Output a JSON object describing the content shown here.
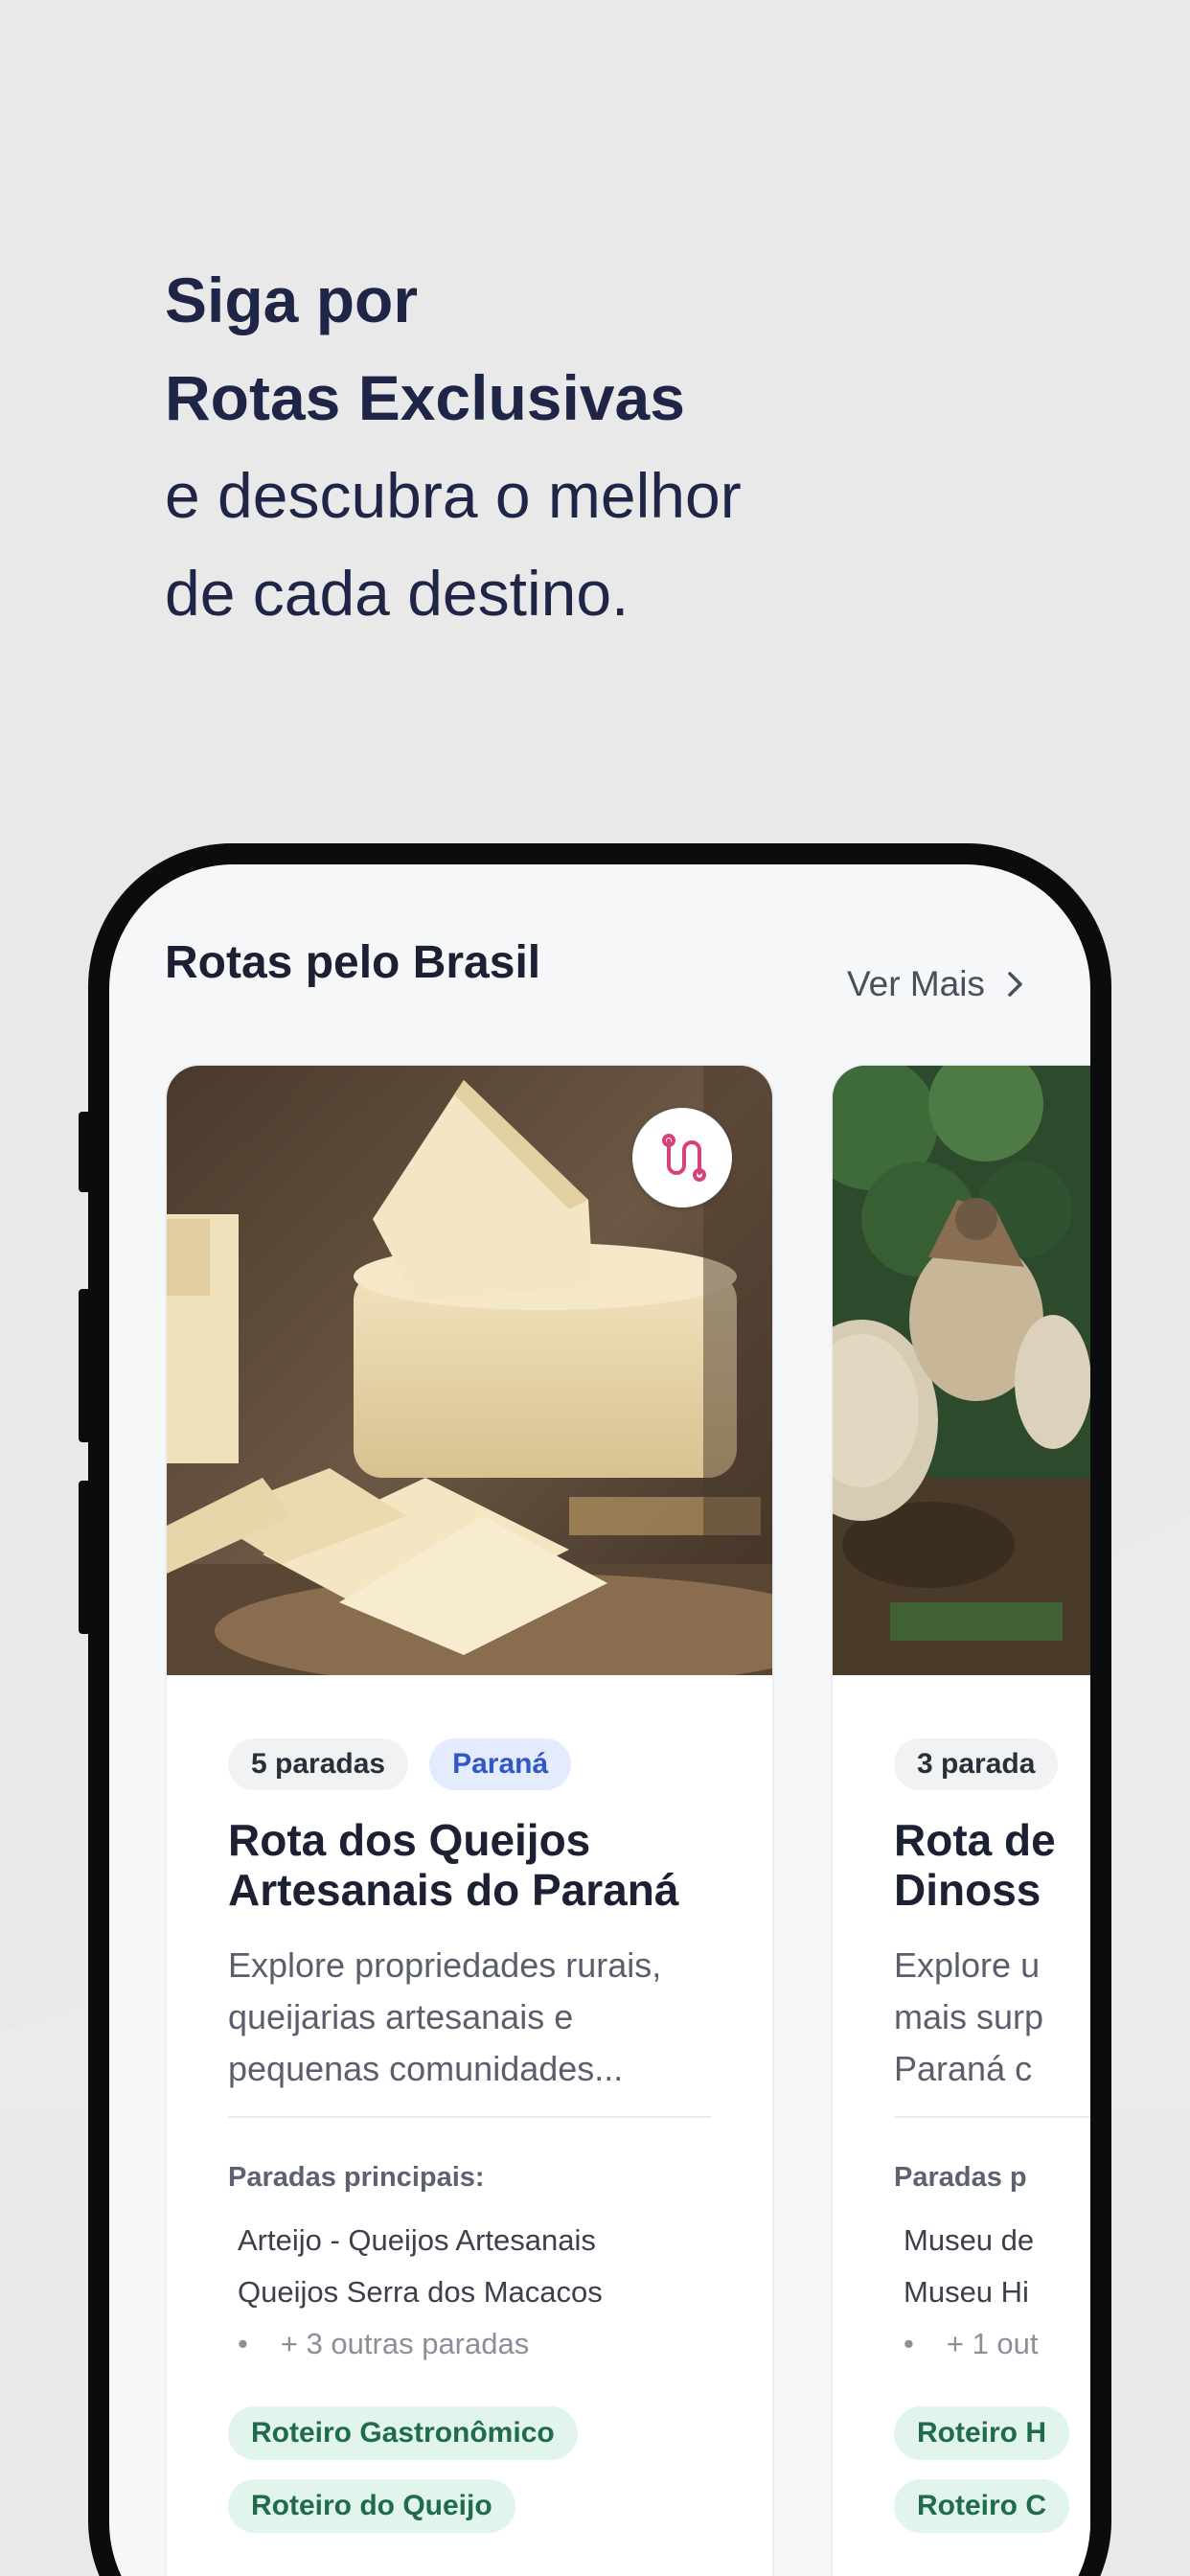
{
  "headline": {
    "line1": "Siga por",
    "line2": "Rotas Exclusivas",
    "line3": "e descubra o melhor",
    "line4": "de cada destino."
  },
  "section": {
    "title": "Rotas pelo Brasil",
    "see_more": "Ver Mais"
  },
  "cards": [
    {
      "stops_count": "5 paradas",
      "state": "Paraná",
      "title": "Rota dos Queijos Artesanais do Paraná",
      "description": "Explore propriedades rurais, queijarias artesanais e pequenas comunidades...",
      "stops_label": "Paradas principais:",
      "stops": [
        "Arteijo - Queijos Artesanais",
        "Queijos Serra dos Macacos"
      ],
      "more_stops": "+ 3 outras paradas",
      "tags": [
        "Roteiro Gastronômico",
        "Roteiro do Queijo"
      ]
    },
    {
      "stops_count": "3 parada",
      "title": "Rota de Dinoss",
      "description": "Explore u mais surp Paraná c",
      "stops_label": "Paradas p",
      "stops": [
        "Museu de",
        "Museu Hi"
      ],
      "more_stops": "+ 1 out",
      "tags": [
        "Roteiro H",
        "Roteiro C"
      ]
    }
  ],
  "colors": {
    "headline": "#1e2547",
    "badge_blue_bg": "#e3ebfc",
    "badge_blue_text": "#2f57c9",
    "tag_green_bg": "#e1f5ec",
    "tag_green_text": "#1f6b4a",
    "route_icon": "#d8407e"
  },
  "icons": {
    "route": "route-icon",
    "chevron": "chevron-right-icon"
  }
}
